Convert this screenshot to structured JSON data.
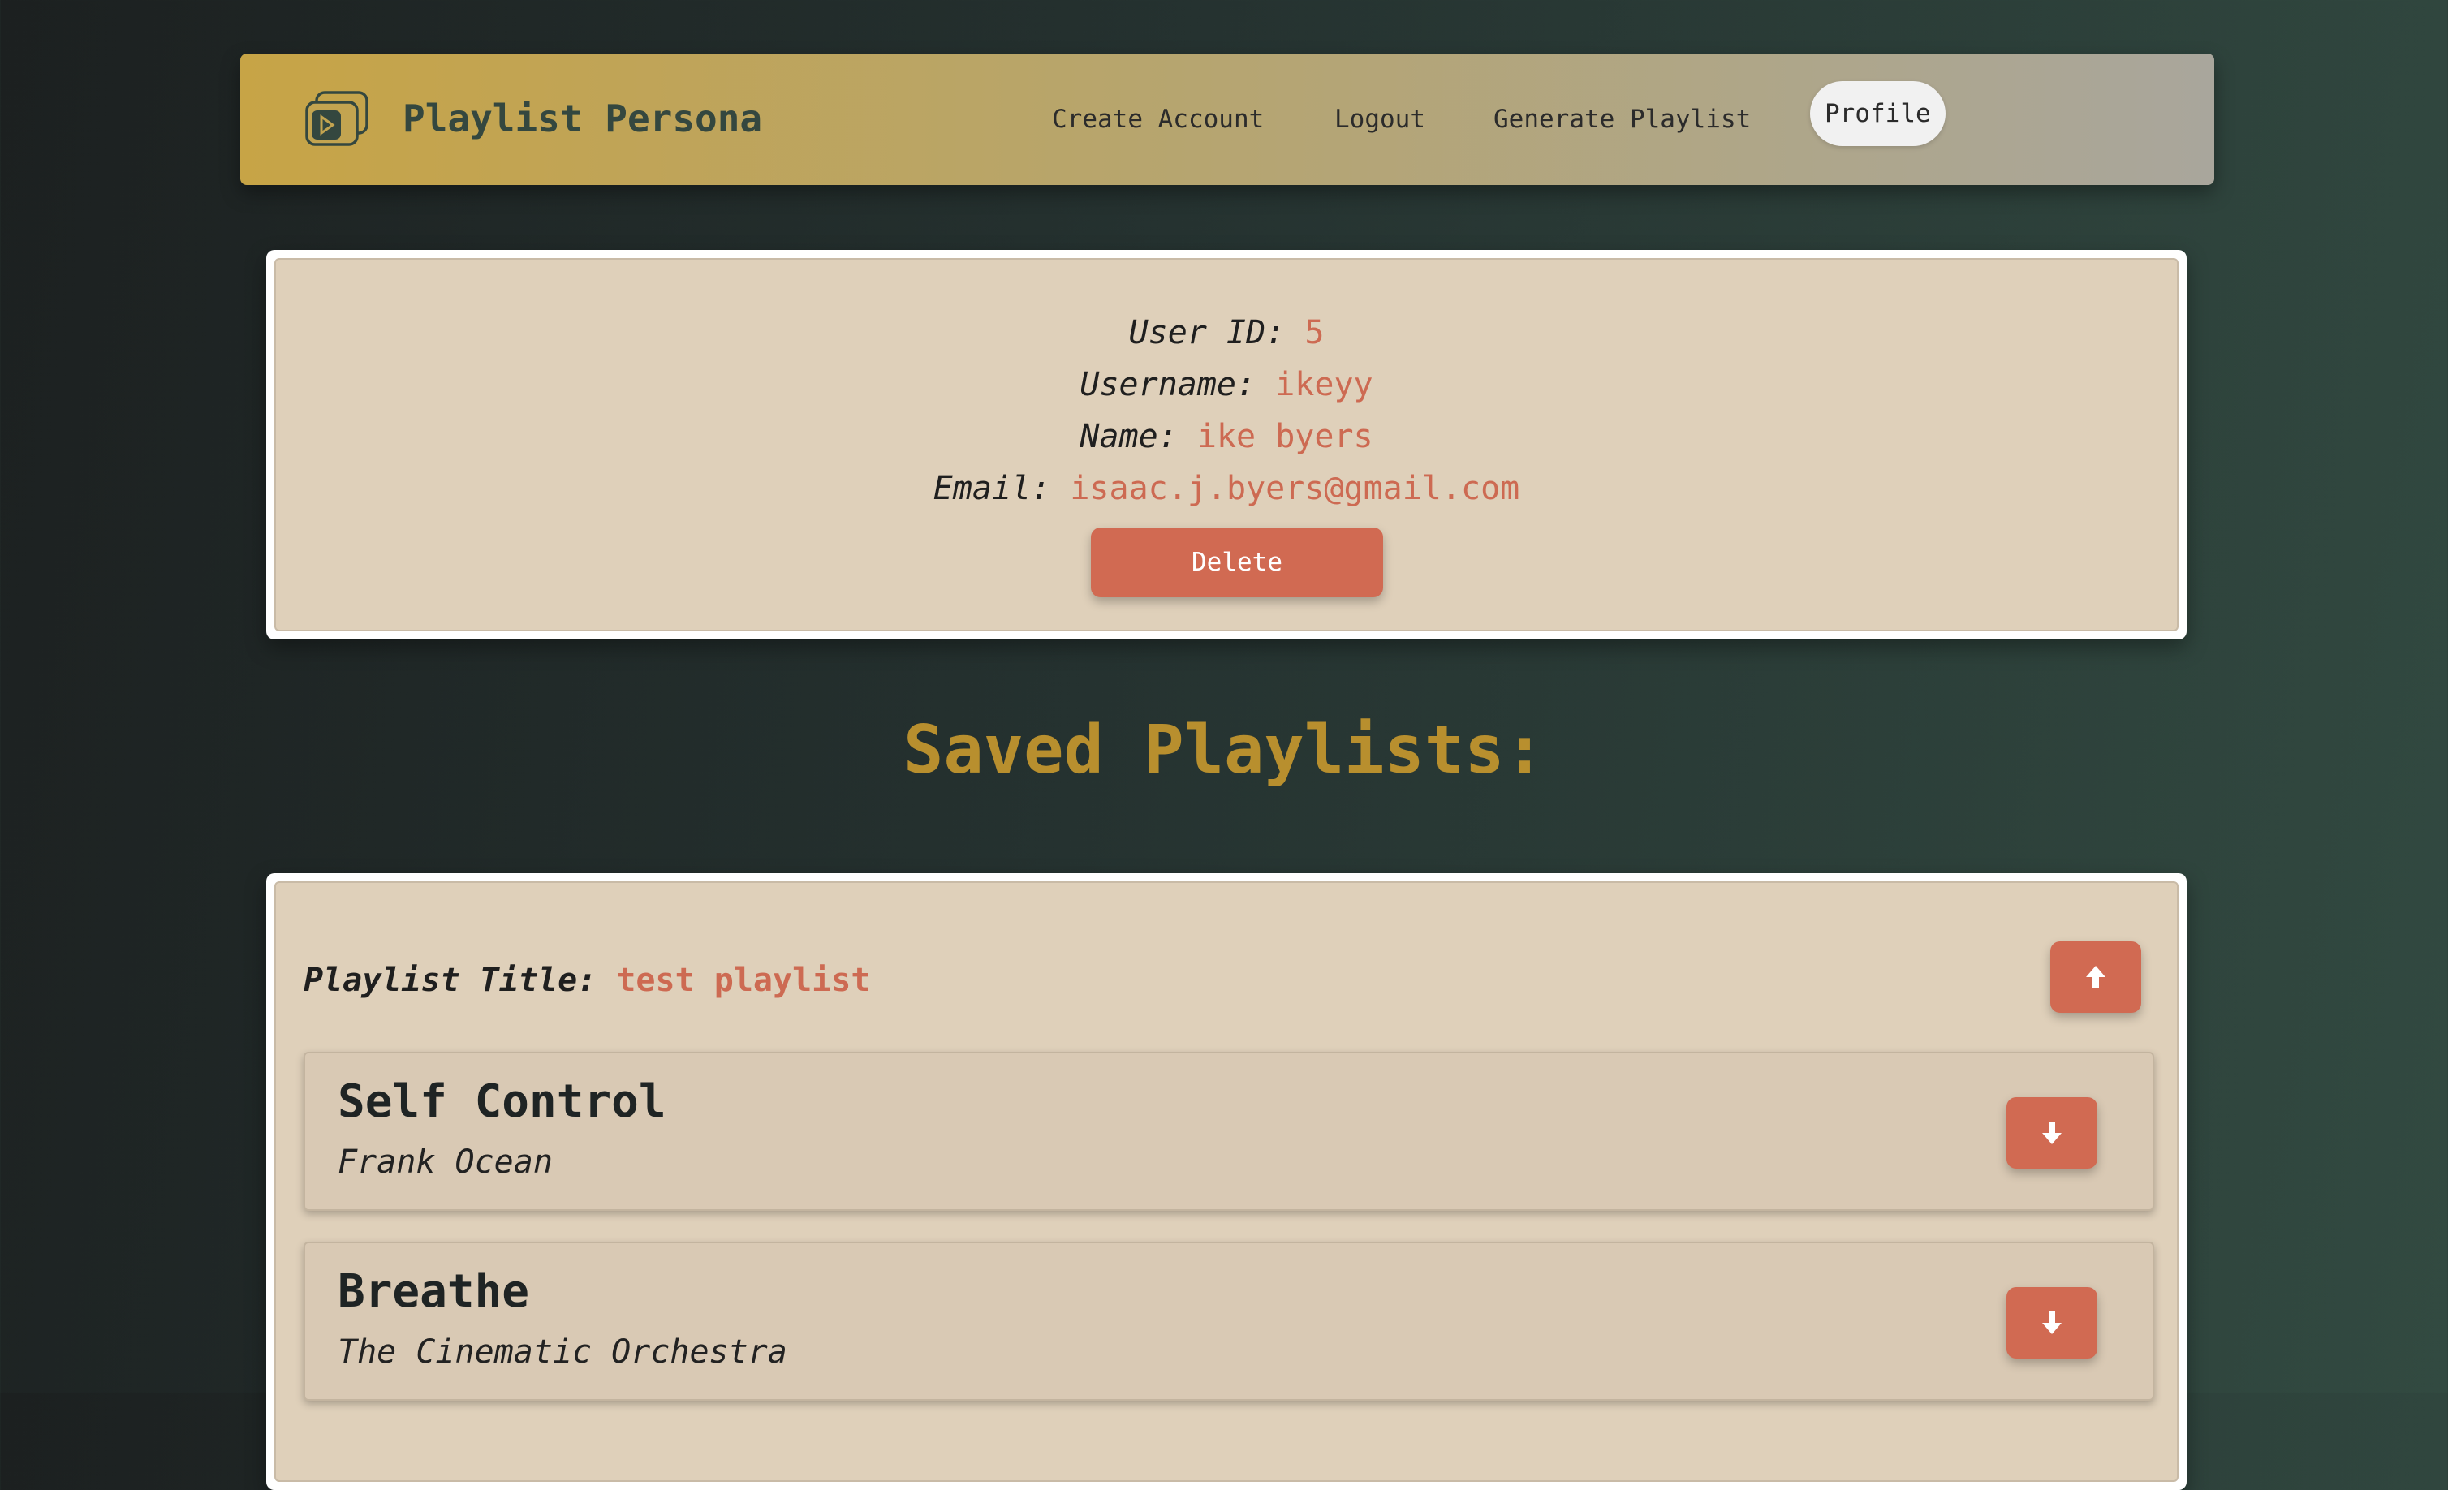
{
  "header": {
    "brand": "Playlist Persona",
    "nav": {
      "create_account": "Create Account",
      "logout": "Logout",
      "generate_playlist": "Generate Playlist",
      "profile": "Profile"
    },
    "active_tab": "Profile"
  },
  "profile": {
    "user_id_label": "User ID:",
    "user_id": "5",
    "username_label": "Username:",
    "username": "ikeyy",
    "name_label": "Name:",
    "name": "ike byers",
    "email_label": "Email:",
    "email": "isaac.j.byers@gmail.com",
    "delete_label": "Delete"
  },
  "saved_playlists": {
    "heading": "Saved Playlists:",
    "playlists": [
      {
        "title_label": "Playlist Title:",
        "title": "test playlist",
        "songs": [
          {
            "title": "Self Control",
            "artist": "Frank Ocean"
          },
          {
            "title": "Breathe",
            "artist": "The Cinematic Orchestra"
          }
        ]
      }
    ]
  },
  "icons": {
    "brand": "playlist-folder-play-icon",
    "collapse": "arrow-up-icon",
    "expand": "arrow-down-icon"
  },
  "colors": {
    "accent": "#d16a52",
    "gold_heading": "#b88f2e",
    "card_background": "#dfd0ba",
    "value_text": "#cd6a52"
  }
}
